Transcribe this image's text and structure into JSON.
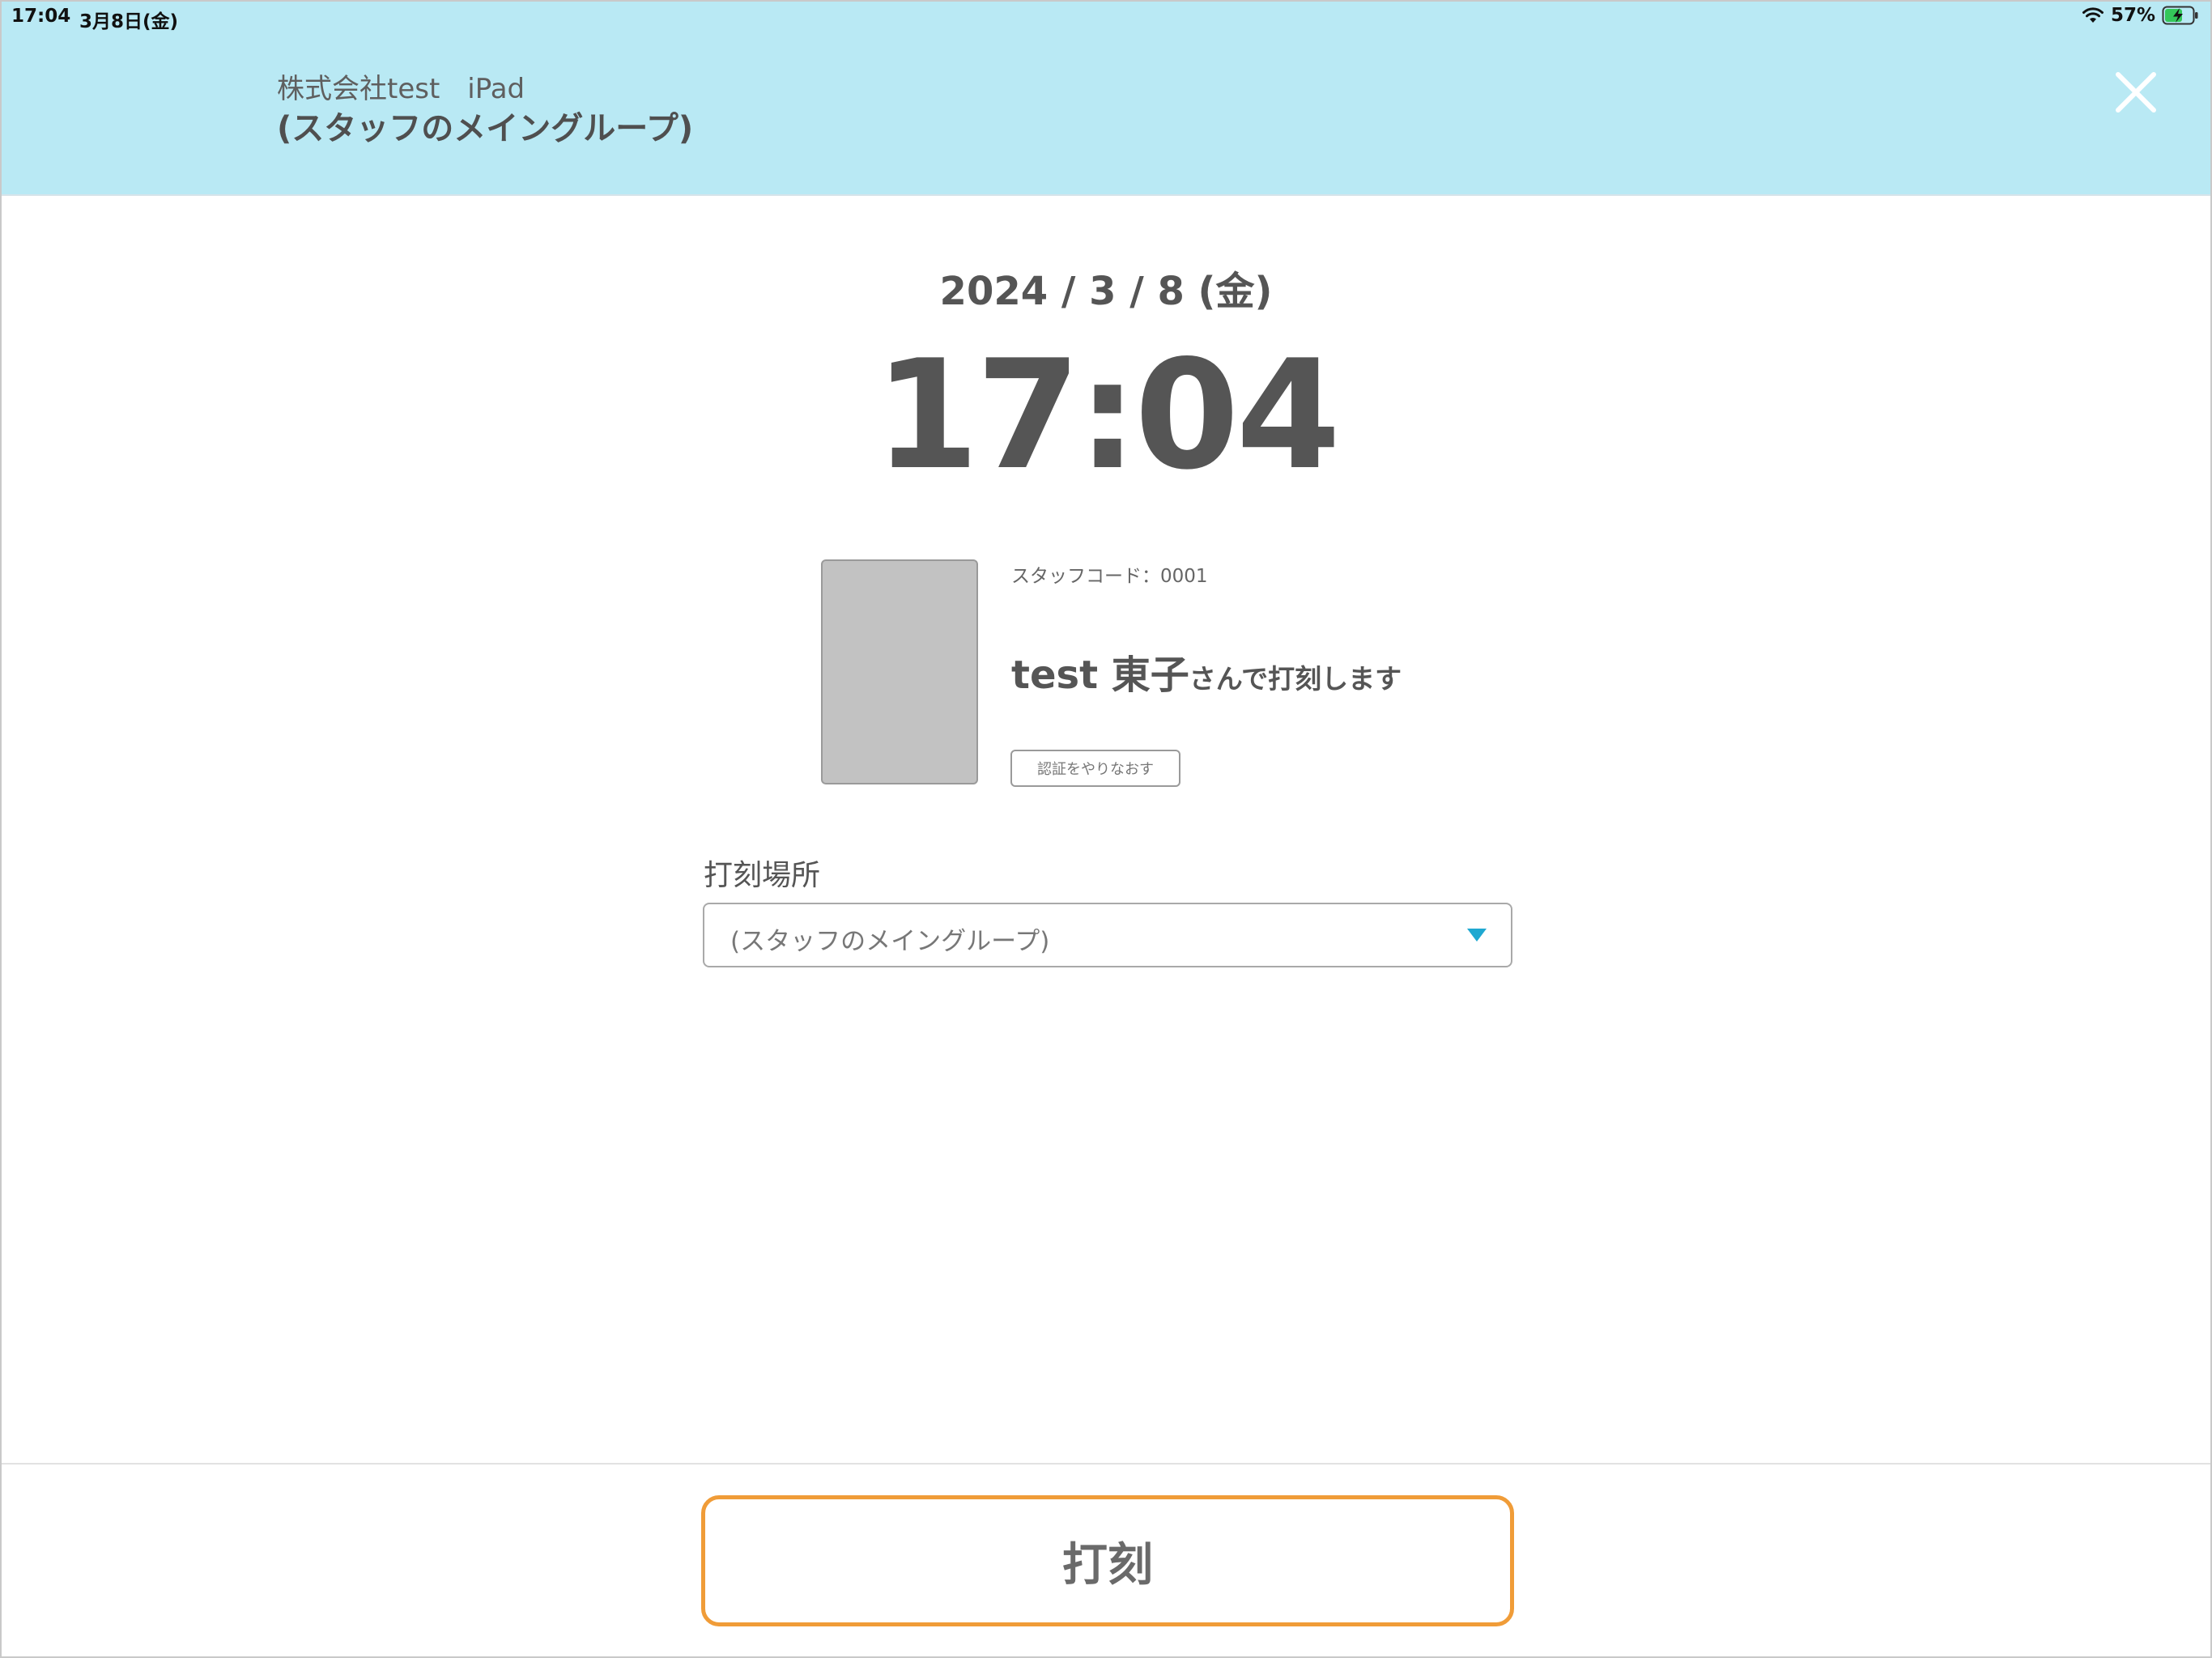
{
  "status_bar": {
    "time": "17:04",
    "date": "3月8日(金)",
    "battery": "57%",
    "battery_level": 0.57,
    "charging": true
  },
  "header": {
    "company": "株式会社test　iPad",
    "group": "(スタッフのメイングループ)",
    "background_color": "#b9e9f4",
    "close_icon": "close-icon"
  },
  "clock": {
    "date": "2024 / 3 / 8 (金)",
    "time": "17:04"
  },
  "staff": {
    "code_label": "スタッフコード：0001",
    "name": "test 東子",
    "suffix": "さんで打刻します",
    "reauth_label": "認証をやりなおす"
  },
  "place": {
    "label": "打刻場所",
    "selected": "(スタッフのメイングループ)",
    "accent_color": "#1fa8d1"
  },
  "actions": {
    "stamp_label": "打刻",
    "stamp_border_color": "#f09c38"
  }
}
